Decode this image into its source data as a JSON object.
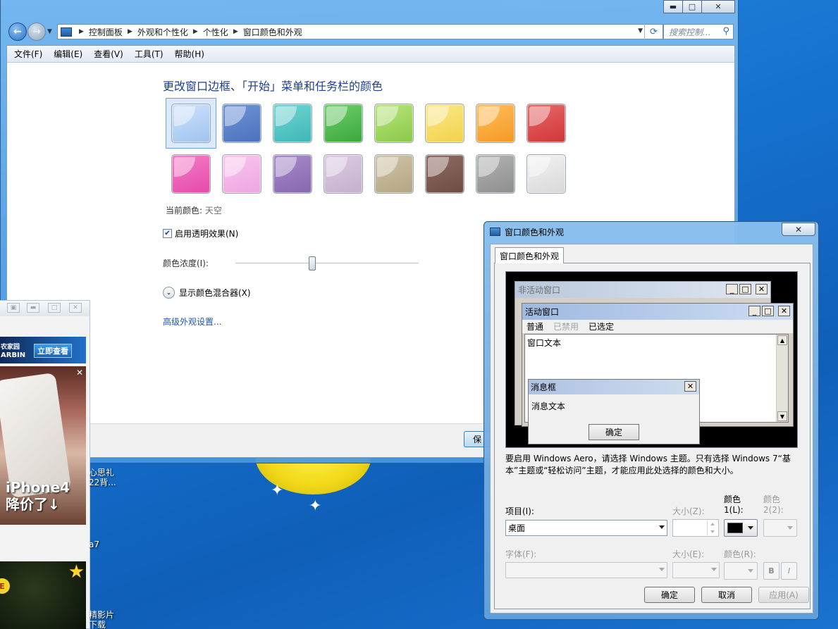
{
  "cp_window": {
    "caption_buttons": {
      "minimize": "▬",
      "maximize": "□",
      "close": "✕"
    },
    "breadcrumbs": [
      "控制面板",
      "外观和个性化",
      "个性化",
      "窗口颜色和外观"
    ],
    "search_placeholder": "搜索控制...",
    "menu": [
      "文件(F)",
      "编辑(E)",
      "查看(V)",
      "工具(T)",
      "帮助(H)"
    ],
    "page_title": "更改窗口边框、「开始」菜单和任务栏的颜色",
    "swatches": [
      {
        "color": "#cfe3fb",
        "accent": "#9ec3ef",
        "selected": true
      },
      {
        "color": "#6f95d6",
        "accent": "#4a72bd",
        "selected": false
      },
      {
        "color": "#6fd6d3",
        "accent": "#3fb6b6",
        "selected": false
      },
      {
        "color": "#6fcf6a",
        "accent": "#3aa83b",
        "selected": false
      },
      {
        "color": "#b8e57a",
        "accent": "#8ac94a",
        "selected": false
      },
      {
        "color": "#fbe88a",
        "accent": "#f2d24a",
        "selected": false
      },
      {
        "color": "#ffbe5c",
        "accent": "#f49a24",
        "selected": false
      },
      {
        "color": "#e86a6a",
        "accent": "#cf3636",
        "selected": false
      },
      {
        "color": "#f57ec8",
        "accent": "#e44aa9",
        "selected": false
      },
      {
        "color": "#f8c6ee",
        "accent": "#eea6e1",
        "selected": false
      },
      {
        "color": "#a88cc9",
        "accent": "#8766b1",
        "selected": false
      },
      {
        "color": "#dbcbe0",
        "accent": "#c5b0cd",
        "selected": false
      },
      {
        "color": "#cfc4a8",
        "accent": "#b4a683",
        "selected": false
      },
      {
        "color": "#8e6c62",
        "accent": "#6f4c43",
        "selected": false
      },
      {
        "color": "#b3b3b3",
        "accent": "#8e8e8e",
        "selected": false
      },
      {
        "color": "#f3f3f3",
        "accent": "#d8d8d8",
        "selected": false
      }
    ],
    "current_color_label": "当前颜色:",
    "current_color_value": "天空",
    "transparency_label": "启用透明效果(N)",
    "transparency_checked": true,
    "intensity_label": "颜色浓度(I):",
    "intensity_value_pct": 42,
    "mixer_label": "显示颜色混合器(X)",
    "advanced_link": "高级外观设置...",
    "save_button_partial": "保"
  },
  "dialog": {
    "title": "窗口颜色和外观",
    "close": "✕",
    "tab": "窗口颜色和外观",
    "preview": {
      "inactive_title": "非活动窗口",
      "active_title": "活动窗口",
      "menu_normal": "普通",
      "menu_disabled": "已禁用",
      "menu_selected": "已选定",
      "window_text": "窗口文本",
      "msg_title": "消息框",
      "msg_text": "消息文本",
      "msg_ok": "确定"
    },
    "note": "要启用 Windows Aero，请选择 Windows 主题。只有选择 Windows 7“基本”主题或“轻松访问”主题，才能应用此处选择的颜色和大小。",
    "item_label": "项目(I):",
    "item_value": "桌面",
    "size_label": "大小(Z):",
    "color1_label_top": "颜色",
    "color1_label_bottom": "1(L):",
    "color1_value": "#000000",
    "color2_label_top": "颜色",
    "color2_label_bottom": "2(2):",
    "font_label": "字体(F):",
    "font_size_label": "大小(E):",
    "font_color_label": "颜色(R):",
    "bold": "B",
    "italic": "I",
    "ok": "确定",
    "cancel": "取消",
    "apply": "应用(A)"
  },
  "ad": {
    "banner_line1": "农家园",
    "banner_line2": "ARBIN",
    "banner_button": "立即查看",
    "close": "✕",
    "phone_text_1": "iPhone4",
    "phone_text_2": "降价了↓"
  },
  "desktop": {
    "label1": "心思礼\n22背...",
    "label2": "a7",
    "label3": "精影片\n下载"
  }
}
